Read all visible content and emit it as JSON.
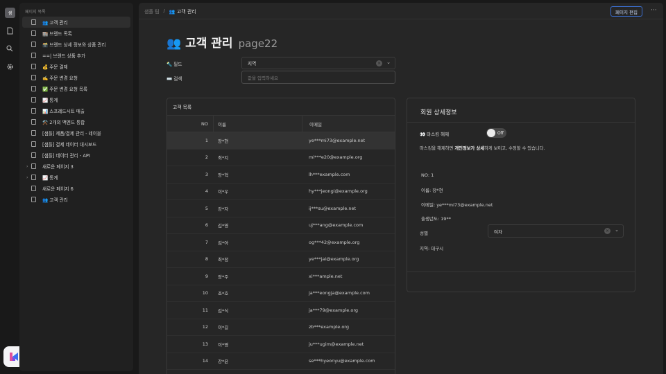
{
  "rail": {
    "workspace_initial": "샘",
    "icons": [
      "page-icon",
      "search-icon",
      "settings-icon"
    ],
    "logo": "app-logo"
  },
  "sidebar": {
    "title": "페이지 목록",
    "items": [
      {
        "label": "👥 고객 관리",
        "active": true,
        "caret": ""
      },
      {
        "label": "🏬 브랜드 목록",
        "caret": ""
      },
      {
        "label": "🗃️ 브랜드 상세 정보와 상품 관리",
        "caret": ""
      },
      {
        "label": "==| 브랜드 상품 추가",
        "caret": ""
      },
      {
        "label": "💰 주문 결제",
        "caret": ""
      },
      {
        "label": "✍️ 주문 변경 요청",
        "caret": ""
      },
      {
        "label": "✅ 주문 변경 요청 목록",
        "caret": ""
      },
      {
        "label": "📈 통계",
        "caret": ""
      },
      {
        "label": "📊 스프레드시트 매출",
        "caret": ""
      },
      {
        "label": "⚒️ 2개의 백엔드 통합",
        "caret": ""
      },
      {
        "label": "[샘플] 제품/결제 관리 - 테이블",
        "caret": ""
      },
      {
        "label": "[샘플] 결제 데이터 대시보드",
        "caret": ""
      },
      {
        "label": "[샘플] 데이터 관리 - API",
        "caret": ""
      },
      {
        "label": "새로운 페이지 3",
        "caret": "›"
      },
      {
        "label": "📈 통계",
        "caret": "›"
      },
      {
        "label": "새로운 페이지 6",
        "caret": ""
      },
      {
        "label": "👥 고객 관리",
        "caret": ""
      }
    ]
  },
  "topbar": {
    "breadcrumb_root": "샘플 팀",
    "breadcrumb_sep": "/",
    "breadcrumb_current": "👥 고객 관리",
    "edit_label": "페이지 편집",
    "more_label": "···"
  },
  "page": {
    "title": "👥 고객 관리",
    "subtitle": "page22"
  },
  "filter": {
    "field_label": "🔦 필드",
    "field_value": "지역",
    "search_label": "⌨️ 검색",
    "search_placeholder": "값을 입력하세요"
  },
  "table": {
    "title": "고객 목록",
    "headers": {
      "no": "NO",
      "name": "이름",
      "email": "이메일"
    },
    "rows": [
      {
        "no": "1",
        "name": "장*현",
        "email": "ye***mi73@example.net"
      },
      {
        "no": "2",
        "name": "최*지",
        "email": "mi***e20@example.org"
      },
      {
        "no": "3",
        "name": "장*혁",
        "email": "lh***example.com"
      },
      {
        "no": "4",
        "name": "이*우",
        "email": "hy***jeongi@example.org"
      },
      {
        "no": "5",
        "name": "강*자",
        "email": "ij***su@example.net"
      },
      {
        "no": "6",
        "name": "김*영",
        "email": "uj***ang@example.com"
      },
      {
        "no": "7",
        "name": "김*아",
        "email": "og***42@example.org"
      },
      {
        "no": "8",
        "name": "최*정",
        "email": "ye***jai@example.org"
      },
      {
        "no": "9",
        "name": "장*주",
        "email": "xi***ample.net"
      },
      {
        "no": "10",
        "name": "조*호",
        "email": "ja***eongja@example.com"
      },
      {
        "no": "11",
        "name": "김*식",
        "email": "ja***79@example.org"
      },
      {
        "no": "12",
        "name": "이*길",
        "email": "zb***example.org"
      },
      {
        "no": "13",
        "name": "이*영",
        "email": "ju***ugim@example.net"
      },
      {
        "no": "14",
        "name": "강*윤",
        "email": "se***hyeonyu@example.com"
      }
    ]
  },
  "detail": {
    "title": "회원 상세정보",
    "mask_label": "👀 마스킹 해제",
    "toggle_text": "Off",
    "desc_prefix": "마스킹을 해제하면 ",
    "desc_bold": "개인정보가 상세",
    "desc_suffix": "하게 보이고, 수정할 수 있습니다.",
    "no": "NO: 1",
    "name": "이름: 장*현",
    "email": "이메일: ye***mi73@example.net",
    "birth": "출생년도: 19**",
    "gender_label": "성별",
    "gender_value": "여자",
    "region": "지역: 대구시"
  }
}
